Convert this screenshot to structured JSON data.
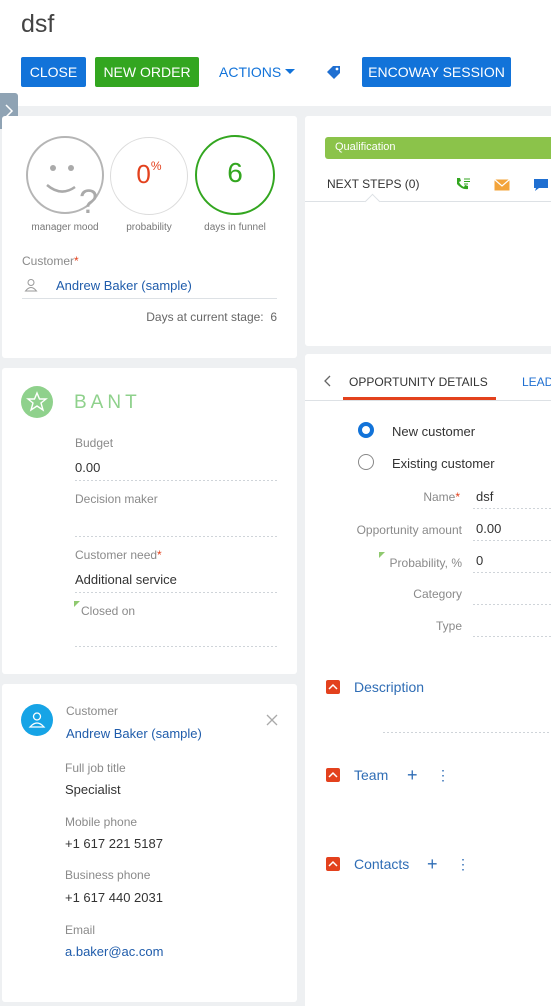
{
  "page": {
    "title": "dsf"
  },
  "toolbar": {
    "close_label": "CLOSE",
    "new_order_label": "NEW ORDER",
    "actions_label": "ACTIONS",
    "encoway_label": "ENCOWAY SESSION"
  },
  "indicators": {
    "mood_label": "manager mood",
    "probability_value": "0",
    "probability_unit": "%",
    "probability_label": "probability",
    "days_value": "6",
    "days_label": "days in funnel"
  },
  "customer_summary": {
    "label": "Customer",
    "value": "Andrew Baker (sample)",
    "days_stage_label": "Days at current stage:",
    "days_stage_value": "6"
  },
  "bant": {
    "title": "BANT",
    "budget_label": "Budget",
    "budget_value": "0.00",
    "decision_maker_label": "Decision maker",
    "decision_maker_value": "",
    "customer_need_label": "Customer need",
    "customer_need_value": "Additional service",
    "closed_on_label": "Closed on",
    "closed_on_value": ""
  },
  "contact_card": {
    "customer_label": "Customer",
    "customer_name": "Andrew Baker (sample)",
    "job_title_label": "Full job title",
    "job_title_value": "Specialist",
    "mobile_label": "Mobile phone",
    "mobile_value": "+1 617 221 5187",
    "business_label": "Business phone",
    "business_value": "+1 617 440 2031",
    "email_label": "Email",
    "email_value": "a.baker@ac.com"
  },
  "stage": {
    "current": "Qualification"
  },
  "next_steps": {
    "label": "NEXT STEPS (0)"
  },
  "tabs": {
    "details": "OPPORTUNITY DETAILS",
    "leads": "LEAD"
  },
  "details": {
    "new_customer_label": "New customer",
    "existing_customer_label": "Existing customer",
    "selected_customer_type": "New customer",
    "name_label": "Name",
    "name_value": "dsf",
    "amount_label": "Opportunity amount",
    "amount_value": "0.00",
    "probability_label": "Probability, %",
    "probability_value": "0",
    "category_label": "Category",
    "category_value": "",
    "type_label": "Type",
    "type_value": ""
  },
  "sections": {
    "description": "Description",
    "team": "Team",
    "contacts": "Contacts"
  },
  "colors": {
    "primary_blue": "#1273d9",
    "green": "#33a620",
    "stage_green": "#8bc34a",
    "required_red": "#e3411d"
  },
  "icons": [
    "tag-icon",
    "chevron-right-icon",
    "smiley-question-icon",
    "user-icon",
    "star-badge-icon",
    "person-avatar-icon",
    "close-icon",
    "phone-icon",
    "email-icon",
    "chat-icon",
    "chevron-left-icon",
    "collapse-icon",
    "plus-icon",
    "more-icon"
  ]
}
